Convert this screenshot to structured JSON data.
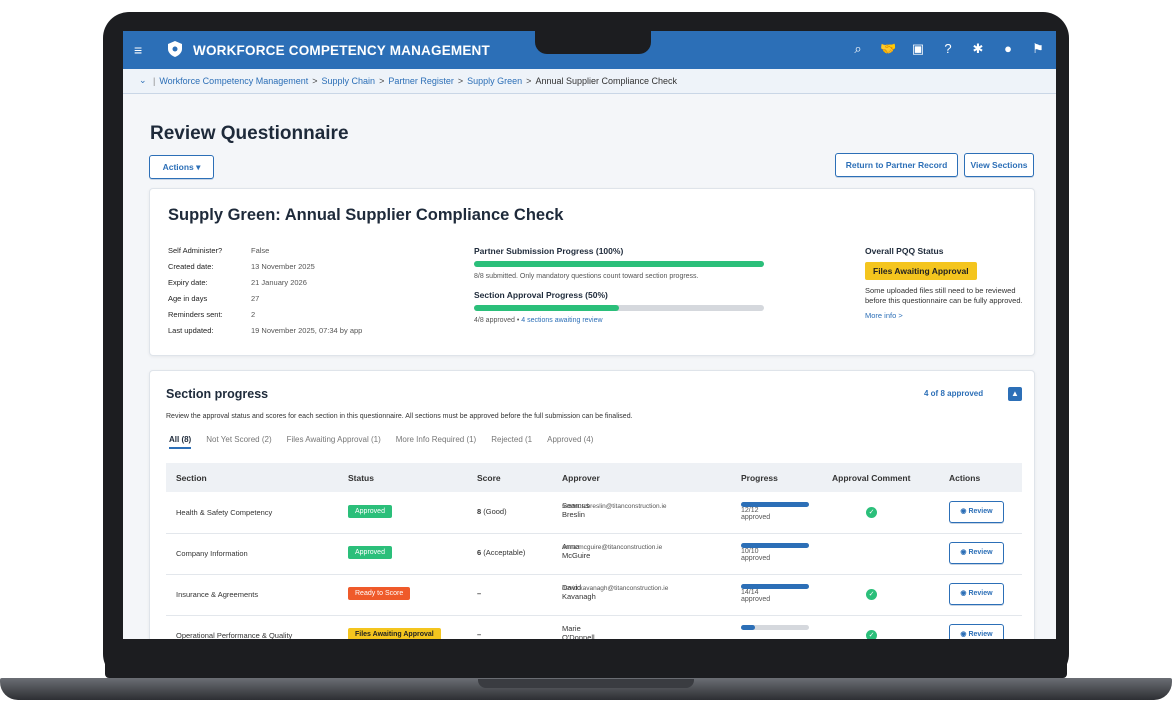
{
  "app": {
    "title": "WORKFORCE COMPETENCY MANAGEMENT"
  },
  "topbar_icons": [
    "search-icon",
    "handshake-icon",
    "tablet-icon",
    "help-icon",
    "gear-icon",
    "user-icon",
    "flag-icon"
  ],
  "breadcrumb": [
    "Workforce Competency Management",
    "Supply Chain",
    "Partner Register",
    "Supply Green",
    "Annual Supplier Compliance Check"
  ],
  "breadcrumb_sep": ">",
  "page": {
    "title": "Review Questionnaire",
    "actions_label": "Actions",
    "return_label": "Return to Partner Record",
    "view_sections_label": "View Sections"
  },
  "summary": {
    "title": "Supply Green: Annual Supplier Compliance Check",
    "meta": [
      {
        "k": "Self Administer?",
        "v": "False"
      },
      {
        "k": "Created date:",
        "v": "13 November 2025"
      },
      {
        "k": "Expiry date:",
        "v": "21 January 2026"
      },
      {
        "k": "Age in days",
        "v": "27"
      },
      {
        "k": "Reminders sent:",
        "v": "2"
      },
      {
        "k": "Last updated:",
        "v": "19 November 2025, 07:34 by app"
      }
    ],
    "submission_label": "Partner Submission Progress (100%)",
    "submission_progress": 1.0,
    "submission_note": "8/8 submitted. Only mandatory questions count toward section progress.",
    "approval_label": "Section Approval Progress (50%)",
    "approval_progress": 0.5,
    "approval_note": "4/8 approved",
    "approval_dot": "•",
    "approval_link": "4 sections awaiting review",
    "overall_heading": "Overall PQQ Status",
    "overall_badge": "Files Awaiting Approval",
    "overall_text": "Some uploaded files still need to be reviewed before this questionnaire can be fully approved.",
    "more_info": "More info >",
    "colors": {
      "green": "#2bbf7a",
      "blue": "#2c6fb7",
      "yellow": "#f4c51e"
    }
  },
  "sections": {
    "title": "Section progress",
    "count": "4 of 8 approved",
    "description": "Review the approval status and scores for each section in this questionnaire. All sections must be approved before the full submission can be finalised.",
    "tabs": [
      "All (8)",
      "Not Yet Scored (2)",
      "Files Awaiting Approval (1)",
      "More Info Required (1)",
      "Rejected (1",
      "Approved (4)"
    ],
    "columns": [
      "Section",
      "Status",
      "Score",
      "Approver",
      "Progress",
      "Approval Comment",
      "Actions"
    ],
    "review_label": "Review",
    "rows": [
      {
        "section": "Health & Safety Competency",
        "status": "Approved",
        "status_type": "green",
        "score": "8",
        "score_desc": "(Good)",
        "approver": "Seamus Breslin",
        "email": "seamus.breslin@titanconstruction.ie",
        "progress": 1.0,
        "progress_text": "12/12 approved",
        "comment": true
      },
      {
        "section": "Company Information",
        "status": "Approved",
        "status_type": "green",
        "score": "6",
        "score_desc": "(Acceptable)",
        "approver": "Anna McGuire",
        "email": "anna.mcguire@titanconstruction.ie",
        "progress": 1.0,
        "progress_text": "10/10 approved",
        "comment": false
      },
      {
        "section": "Insurance & Agreements",
        "status": "Ready to Score",
        "status_type": "red",
        "score": "–",
        "score_desc": "",
        "approver": "David Kavanagh",
        "email": "david.kavanagh@titanconstruction.ie",
        "progress": 1.0,
        "progress_text": "14/14 approved",
        "comment": true
      },
      {
        "section": "Operational Performance & Quality",
        "status": "Files Awaiting Approval",
        "status_type": "yellow",
        "score": "–",
        "score_desc": "",
        "approver": "Marie O'Donnell",
        "email": "",
        "progress": 0.2,
        "progress_text": "",
        "comment": true
      }
    ]
  }
}
